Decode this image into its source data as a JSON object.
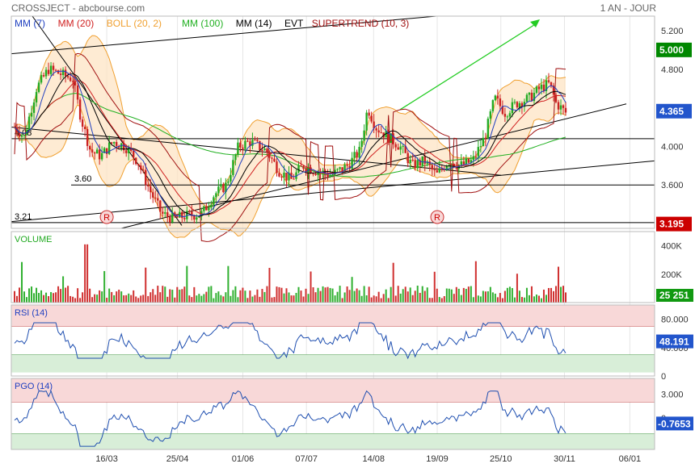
{
  "header": {
    "title": "CROSSJECT - abcbourse.com",
    "timeframe": "1 AN - JOUR"
  },
  "colors": {
    "blue": "#2040c0",
    "red": "#d02020",
    "orange": "#f0a030",
    "green": "#20b020",
    "black": "#000000",
    "darkred": "#a01010",
    "volUp": "#30b030",
    "volDown": "#d03030",
    "rsiBand": "#f8d8d8",
    "lowBand": "#d8eed8",
    "lastBlue": "#2255cc"
  },
  "chart_data": [
    {
      "type": "candlestick",
      "legend": [
        {
          "label": "MM (7)",
          "color": "#2040c0"
        },
        {
          "label": "MM (20)",
          "color": "#d02020"
        },
        {
          "label": "BOLL (20, 2)",
          "color": "#f0a030"
        },
        {
          "label": "MM (100)",
          "color": "#20b020"
        },
        {
          "label": "MM (14)",
          "color": "#000000"
        },
        {
          "label": "EVT",
          "color": "#000000"
        },
        {
          "label": "SUPERTREND (10, 3)",
          "color": "#a01010"
        }
      ],
      "ylim": [
        3.15,
        5.35
      ],
      "yticks": [
        "5.200",
        "4.800",
        "4.400",
        "4.000",
        "3.600"
      ],
      "ytick_values": [
        5.2,
        4.8,
        4.4,
        4.0,
        3.6
      ],
      "last_price": "4.365",
      "level_labels": [
        {
          "text": "5.000",
          "value": 5.0,
          "bg": "#008800"
        },
        {
          "text": "4.365",
          "value": 4.365,
          "bg": "#2255cc"
        },
        {
          "text": "3.195",
          "value": 3.195,
          "bg": "#cc0000"
        }
      ],
      "hlines": [
        {
          "label": "4.08",
          "value": 4.08
        },
        {
          "label": "3.60",
          "value": 3.6
        },
        {
          "label": "3.21",
          "value": 3.21
        }
      ],
      "markers": [
        {
          "text": "R",
          "date": "2021-03-16"
        },
        {
          "text": "R",
          "date": "2021-09-19"
        }
      ]
    },
    {
      "type": "bar",
      "title": "VOLUME",
      "yticks": [
        "400K",
        "200K"
      ],
      "ytick_values": [
        400000,
        200000
      ],
      "last_value": "25 251"
    },
    {
      "type": "line",
      "title": "RSI (14)",
      "ylim": [
        0,
        100
      ],
      "yticks": [
        "80.000",
        "40.000",
        "0"
      ],
      "ytick_values": [
        80,
        40,
        0
      ],
      "last_value": "48.191"
    },
    {
      "type": "line",
      "title": "PGO (14)",
      "ylim": [
        -4,
        5
      ],
      "yticks": [
        "3.000",
        "0"
      ],
      "ytick_values": [
        3,
        0
      ],
      "last_value": "-0.7653"
    }
  ],
  "x_axis": {
    "ticks": [
      {
        "label": "16/03",
        "date": "2021-03-16"
      },
      {
        "label": "25/04",
        "date": "2021-04-25"
      },
      {
        "label": "01/06",
        "date": "2021-06-01"
      },
      {
        "label": "07/07",
        "date": "2021-07-07"
      },
      {
        "label": "14/08",
        "date": "2021-08-14"
      },
      {
        "label": "19/09",
        "date": "2021-09-19"
      },
      {
        "label": "25/10",
        "date": "2021-10-25"
      },
      {
        "label": "30/11",
        "date": "2021-11-30"
      },
      {
        "label": "06/01",
        "date": "2022-01-06"
      }
    ],
    "start_date": "2021-01-21",
    "end_date": "2022-01-20"
  }
}
